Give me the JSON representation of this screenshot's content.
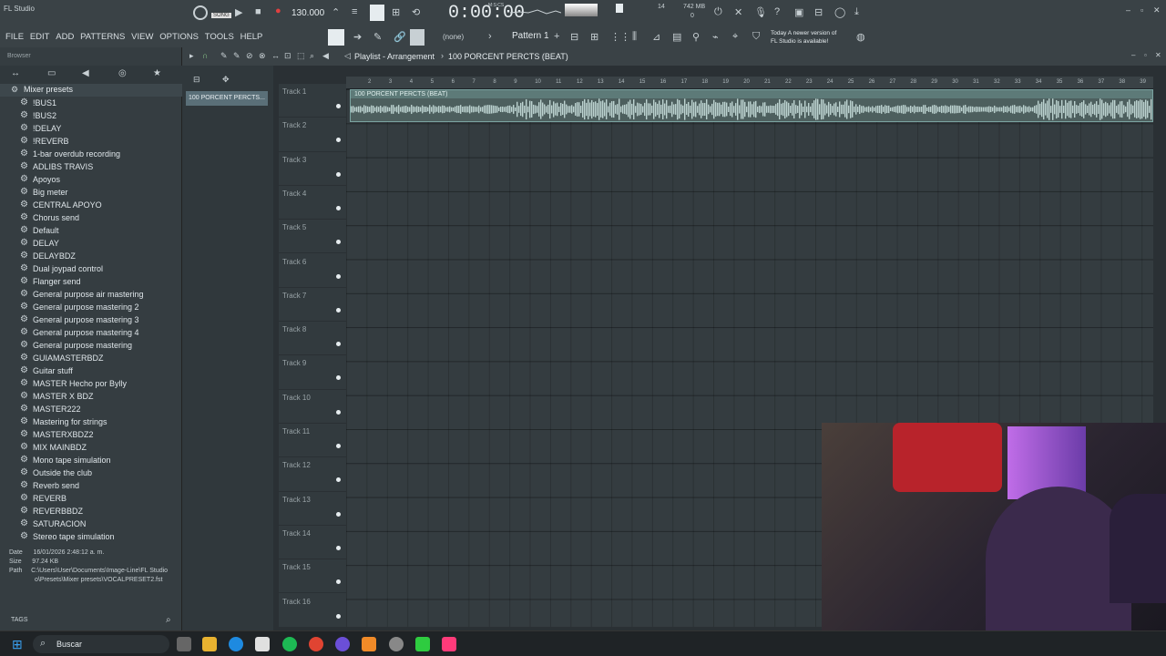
{
  "app": {
    "title": "FL Studio"
  },
  "transport": {
    "mode": "SONG",
    "tempo": "130.000",
    "time": "0:00:00",
    "time_unit": "M:S:CS",
    "memory": "742 MB",
    "cpu": "14",
    "voices": "0"
  },
  "menu": [
    "FILE",
    "EDIT",
    "ADD",
    "PATTERNS",
    "VIEW",
    "OPTIONS",
    "TOOLS",
    "HELP"
  ],
  "toolbar": {
    "snap": "(none)",
    "pattern": "Pattern 1"
  },
  "notice": {
    "line1": "Today  A newer version of",
    "line2": "FL Studio is available!"
  },
  "browser": {
    "label": "Browser",
    "folder": "Mixer presets"
  },
  "presets": [
    "!BUS1",
    "!BUS2",
    "!DELAY",
    "!REVERB",
    "1-bar overdub recording",
    "ADLIBS TRAVIS",
    "Apoyos",
    "Big meter",
    "CENTRAL APOYO",
    "Chorus send",
    "Default",
    "DELAY",
    "DELAYBDZ",
    "Dual joypad control",
    "Flanger send",
    "General purpose air mastering",
    "General purpose mastering 2",
    "General purpose mastering 3",
    "General purpose mastering 4",
    "General purpose mastering",
    "GUIAMASTERBDZ",
    "Guitar stuff",
    "MASTER Hecho por Bylly",
    "MASTER X BDZ",
    "MASTER222",
    "Mastering for strings",
    "MASTERXBDZ2",
    "MIX MAINBDZ",
    "Mono tape simulation",
    "Outside the club",
    "Reverb send",
    "REVERB",
    "REVERBBDZ",
    "SATURACION",
    "Stereo tape simulation"
  ],
  "fileinfo": {
    "date_label": "Date",
    "date": "16/01/2026 2:48:12 a. m.",
    "size_label": "Size",
    "size": "97.24 KB",
    "path_label": "Path",
    "path1": "C:\\Users\\User\\Documents\\Image-Line\\FL Studio",
    "path2": "o\\Presets\\Mixer presets\\VOCALPRESET2.fst"
  },
  "tags_label": "TAGS",
  "playlist": {
    "title": "Playlist - Arrangement",
    "pattern": "100 PORCENT PERCTS (BEAT)",
    "picker_item": "100 PORCENT PERCTS...",
    "clip_name": "100 PORCENT PERCTS (BEAT)"
  },
  "ruler": [
    "2",
    "3",
    "4",
    "5",
    "6",
    "7",
    "8",
    "9",
    "10",
    "11",
    "12",
    "13",
    "14",
    "15",
    "16",
    "17",
    "18",
    "19",
    "20",
    "21",
    "22",
    "23",
    "24",
    "25",
    "26",
    "27",
    "28",
    "29",
    "30",
    "31",
    "32",
    "33",
    "34",
    "35",
    "36",
    "37",
    "38",
    "39"
  ],
  "tracks": [
    "Track 1",
    "Track 2",
    "Track 3",
    "Track 4",
    "Track 5",
    "Track 6",
    "Track 7",
    "Track 8",
    "Track 9",
    "Track 10",
    "Track 11",
    "Track 12",
    "Track 13",
    "Track 14",
    "Track 15",
    "Track 16"
  ],
  "taskbar": {
    "search": "Buscar"
  }
}
